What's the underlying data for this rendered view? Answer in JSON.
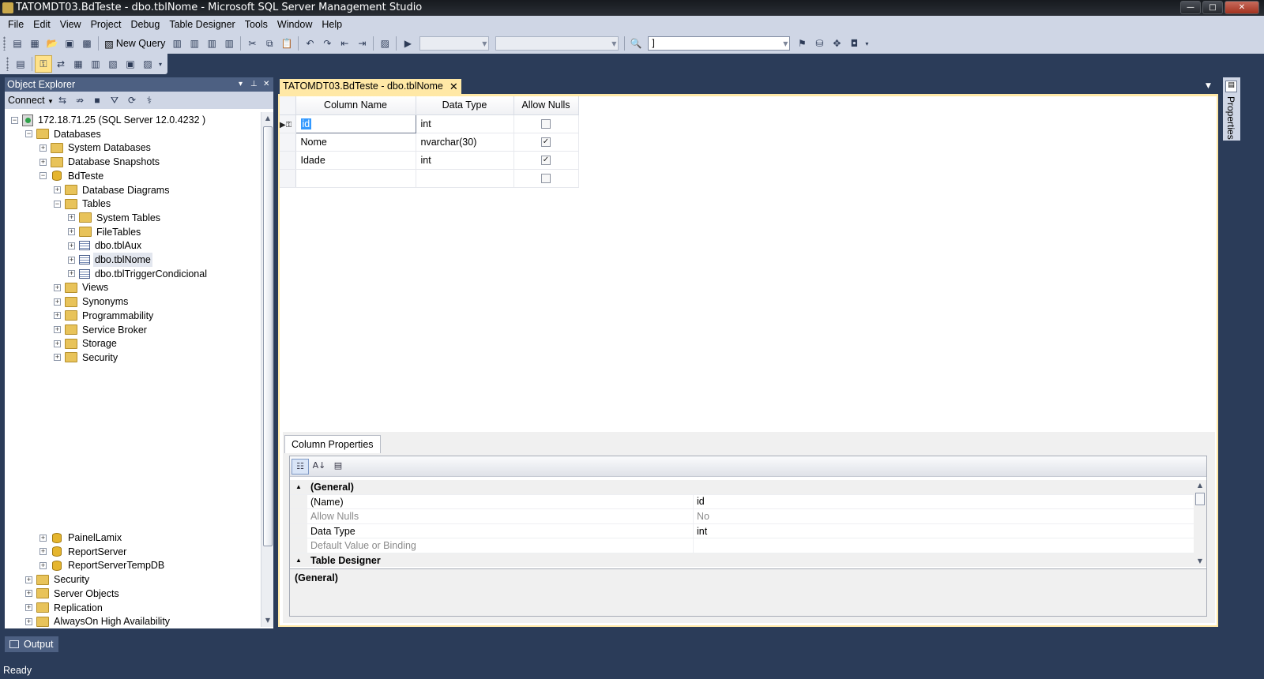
{
  "window": {
    "title": "TATOMDT03.BdTeste - dbo.tblNome - Microsoft SQL Server Management Studio",
    "min": "—",
    "max": "□",
    "close": "✕"
  },
  "menu": [
    "File",
    "Edit",
    "View",
    "Project",
    "Debug",
    "Table Designer",
    "Tools",
    "Window",
    "Help"
  ],
  "toolbar": {
    "new_query": "New Query",
    "search_value": "]"
  },
  "object_explorer": {
    "title": "Object Explorer",
    "pin": "⊥",
    "close": "✕",
    "dropdown": "▾",
    "connect": "Connect",
    "tree": [
      {
        "label": "172.18.71.25 (SQL Server 12.0.4232   )",
        "depth": 0,
        "exp": "−",
        "icon": "server-icon"
      },
      {
        "label": "Databases",
        "depth": 1,
        "exp": "−",
        "icon": "folder-icon"
      },
      {
        "label": "System Databases",
        "depth": 2,
        "exp": "+",
        "icon": "folder-icon"
      },
      {
        "label": "Database Snapshots",
        "depth": 2,
        "exp": "+",
        "icon": "folder-icon"
      },
      {
        "label": "BdTeste",
        "depth": 2,
        "exp": "−",
        "icon": "database-icon"
      },
      {
        "label": "Database Diagrams",
        "depth": 3,
        "exp": "+",
        "icon": "folder-icon"
      },
      {
        "label": "Tables",
        "depth": 3,
        "exp": "−",
        "icon": "folder-icon"
      },
      {
        "label": "System Tables",
        "depth": 4,
        "exp": "+",
        "icon": "folder-icon"
      },
      {
        "label": "FileTables",
        "depth": 4,
        "exp": "+",
        "icon": "folder-icon"
      },
      {
        "label": "dbo.tblAux",
        "depth": 4,
        "exp": "+",
        "icon": "table-icon"
      },
      {
        "label": "dbo.tblNome",
        "depth": 4,
        "exp": "+",
        "icon": "table-icon",
        "selected": true
      },
      {
        "label": "dbo.tblTriggerCondicional",
        "depth": 4,
        "exp": "+",
        "icon": "table-icon"
      },
      {
        "label": "Views",
        "depth": 3,
        "exp": "+",
        "icon": "folder-icon"
      },
      {
        "label": "Synonyms",
        "depth": 3,
        "exp": "+",
        "icon": "folder-icon"
      },
      {
        "label": "Programmability",
        "depth": 3,
        "exp": "+",
        "icon": "folder-icon"
      },
      {
        "label": "Service Broker",
        "depth": 3,
        "exp": "+",
        "icon": "folder-icon"
      },
      {
        "label": "Storage",
        "depth": 3,
        "exp": "+",
        "icon": "folder-icon"
      },
      {
        "label": "Security",
        "depth": 3,
        "exp": "+",
        "icon": "folder-icon"
      }
    ],
    "tree_bottom": [
      {
        "label": "PainelLamix",
        "depth": 2,
        "exp": "+",
        "icon": "database-icon"
      },
      {
        "label": "ReportServer",
        "depth": 2,
        "exp": "+",
        "icon": "database-icon"
      },
      {
        "label": "ReportServerTempDB",
        "depth": 2,
        "exp": "+",
        "icon": "database-icon"
      },
      {
        "label": "Security",
        "depth": 1,
        "exp": "+",
        "icon": "folder-icon"
      },
      {
        "label": "Server Objects",
        "depth": 1,
        "exp": "+",
        "icon": "folder-icon"
      },
      {
        "label": "Replication",
        "depth": 1,
        "exp": "+",
        "icon": "folder-icon"
      },
      {
        "label": "AlwaysOn High Availability",
        "depth": 1,
        "exp": "+",
        "icon": "folder-icon"
      }
    ]
  },
  "doc_tab": {
    "label": "TATOMDT03.BdTeste - dbo.tblNome",
    "close": "✕"
  },
  "designer": {
    "headers": [
      "Column Name",
      "Data Type",
      "Allow Nulls"
    ],
    "rows": [
      {
        "name": "id",
        "type": "int",
        "nulls": false,
        "pk": true
      },
      {
        "name": "Nome",
        "type": "nvarchar(30)",
        "nulls": true
      },
      {
        "name": "Idade",
        "type": "int",
        "nulls": true
      },
      {
        "name": "",
        "type": "",
        "nulls": false
      }
    ]
  },
  "column_properties": {
    "tab": "Column Properties",
    "rows": [
      {
        "kind": "cat",
        "toggle": "▲",
        "name": "(General)",
        "value": ""
      },
      {
        "kind": "prop",
        "name": "(Name)",
        "value": "id"
      },
      {
        "kind": "dim",
        "name": "Allow Nulls",
        "value": "No"
      },
      {
        "kind": "prop",
        "name": "Data Type",
        "value": "int"
      },
      {
        "kind": "dim",
        "name": "Default Value or Binding",
        "value": ""
      },
      {
        "kind": "cat",
        "toggle": "▲",
        "name": "Table Designer",
        "value": ""
      }
    ],
    "description": "(General)"
  },
  "properties_strip": "Properties",
  "output_tab": "Output",
  "status": "Ready"
}
